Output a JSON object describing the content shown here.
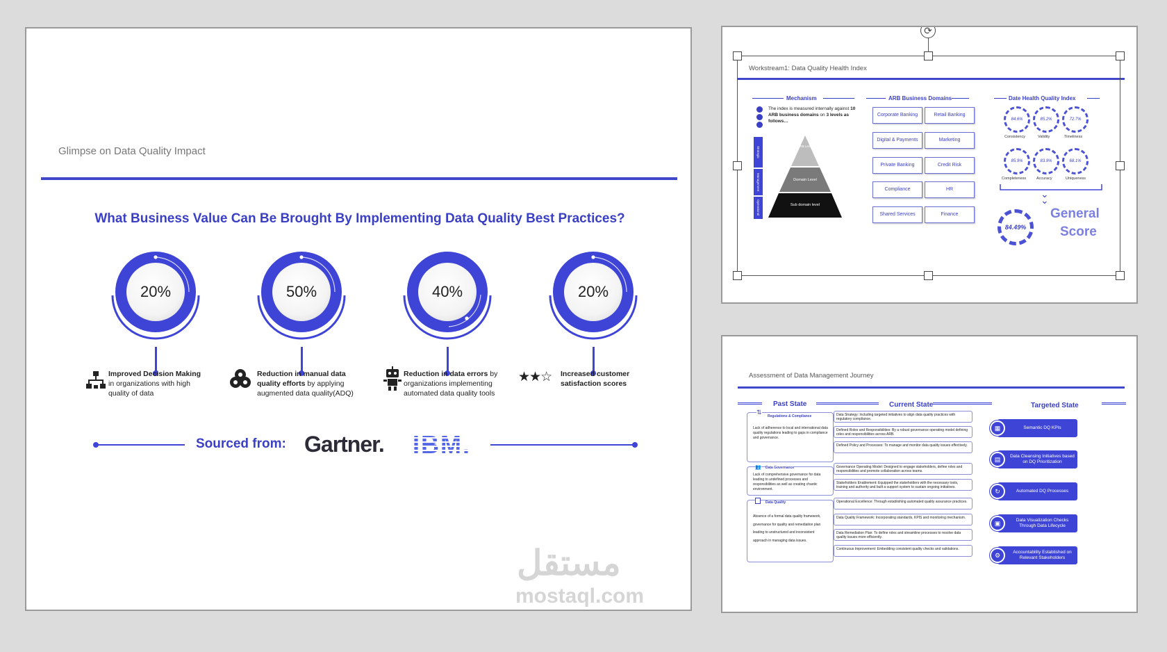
{
  "main": {
    "title": "Glimpse on Data Quality Impact",
    "question": "What Business Value Can Be Brought By Implementing Data Quality Best Practices?",
    "stats": [
      {
        "value": "20%",
        "bold": "Improved Decision Making",
        "text": " in organizations with high quality of data",
        "icon": "hierarchy-icon"
      },
      {
        "value": "50%",
        "bold": "Reduction in manual data quality efforts",
        "text": " by applying augmented data quality(ADQ)",
        "icon": "people-group-icon"
      },
      {
        "value": "40%",
        "bold": "Reduction in data errors",
        "text": " by organizations implementing automated data quality tools",
        "icon": "robot-icon"
      },
      {
        "value": "20%",
        "bold": "Increased customer satisfaction scores",
        "text": "",
        "icon": "three-stars-icon"
      }
    ],
    "sourced_label": "Sourced from:",
    "source_logos": [
      "Gartner.",
      "IBM."
    ],
    "watermark": {
      "arabic": "مستقل",
      "latin": "mostaql.com"
    },
    "accent": "#3e44d6"
  },
  "top_slide": {
    "title": "Workstream1: Data Quality Health Index",
    "mechanism": {
      "heading": "Mechanism",
      "description_pre": "The index is measured internally against ",
      "description_bold": "10 ARB business domains",
      "description_mid": " on ",
      "description_bold2": "3 levels as follows…",
      "side_labels": [
        "Strategic",
        "Management",
        "Operational"
      ],
      "pyramid_levels": [
        "ARB Level",
        "Domain Level",
        "Sub domain level"
      ]
    },
    "domains": {
      "heading": "ARB Business Domains",
      "items": [
        "Corporate Banking",
        "Retail Banking",
        "Digital & Payments",
        "Marketing",
        "Private Banking",
        "Credit Risk",
        "Compliance",
        "HR",
        "Shared Services",
        "Finance"
      ]
    },
    "health_index": {
      "heading": "Date Health Quality Index",
      "gauges": [
        {
          "value": "84.6%",
          "label": "Consistency"
        },
        {
          "value": "85.2%",
          "label": "Validity"
        },
        {
          "value": "72.7%",
          "label": "Timeliness"
        },
        {
          "value": "85.9%",
          "label": "Completeness"
        },
        {
          "value": "83.9%",
          "label": "Accuracy"
        },
        {
          "value": "68.1%",
          "label": "Uniqueness"
        }
      ],
      "general_value": "84.49%",
      "general_label_1": "General",
      "general_label_2": "Score"
    }
  },
  "bottom_slide": {
    "title": "Assessment of Data Management Journey",
    "past_state": {
      "heading": "Past State",
      "sections": [
        {
          "title": "Regulations & Compliance",
          "text": "Lack of adherence to local and international data quality regulations leading to gaps in compliance and governance."
        },
        {
          "title": "Data Governance",
          "text": "Lack of comprehensive governance for data leading to undefined processes and responsibilities as well as creating chaotic environment."
        },
        {
          "title": "Data Quality",
          "text": "Absence of a formal data quality framework, governance for quality and remediation plan leading to unstructured and inconsistent approach in managing data issues."
        }
      ]
    },
    "current_state": {
      "heading": "Current State",
      "items": [
        "Data Strategy: Including targeted initiatives to align data quality practices with regulatory compliance.",
        "Defined Roles and Responsibilities: By a robust governance operating model defining roles and responsibilities across ARB.",
        "Defined Policy and Processes: To manage and monitor data quality issues effectively.",
        "Governance Operating Model: Designed to engage stakeholders, define roles and responsibilities and promote collaboration across teams.",
        "Stakeholders Enablement: Equipped the stakeholders with the necessary tools, training and authority and built a support system to sustain ongoing initiatives.",
        "Operational Excellence: Through establishing automated quality assurance practices.",
        "Data Quality Framework: Incorporating standards, KPIS and monitoring mechanism.",
        "Data Remediation Plan: To define roles and streamline processes to resolve data quality issues more efficiently.",
        "Continuous Improvement: Embedding consistent quality checks and validations."
      ]
    },
    "targeted_state": {
      "heading": "Targeted State",
      "items": [
        "Semantic DQ KPIs",
        "Data Cleansing Initiatives based on DQ Prioritization",
        "Automated DQ Processes",
        "Data Visualization Checks Through Data Lifecycle",
        "Accountability Established on Relevant Stakeholders"
      ]
    }
  }
}
